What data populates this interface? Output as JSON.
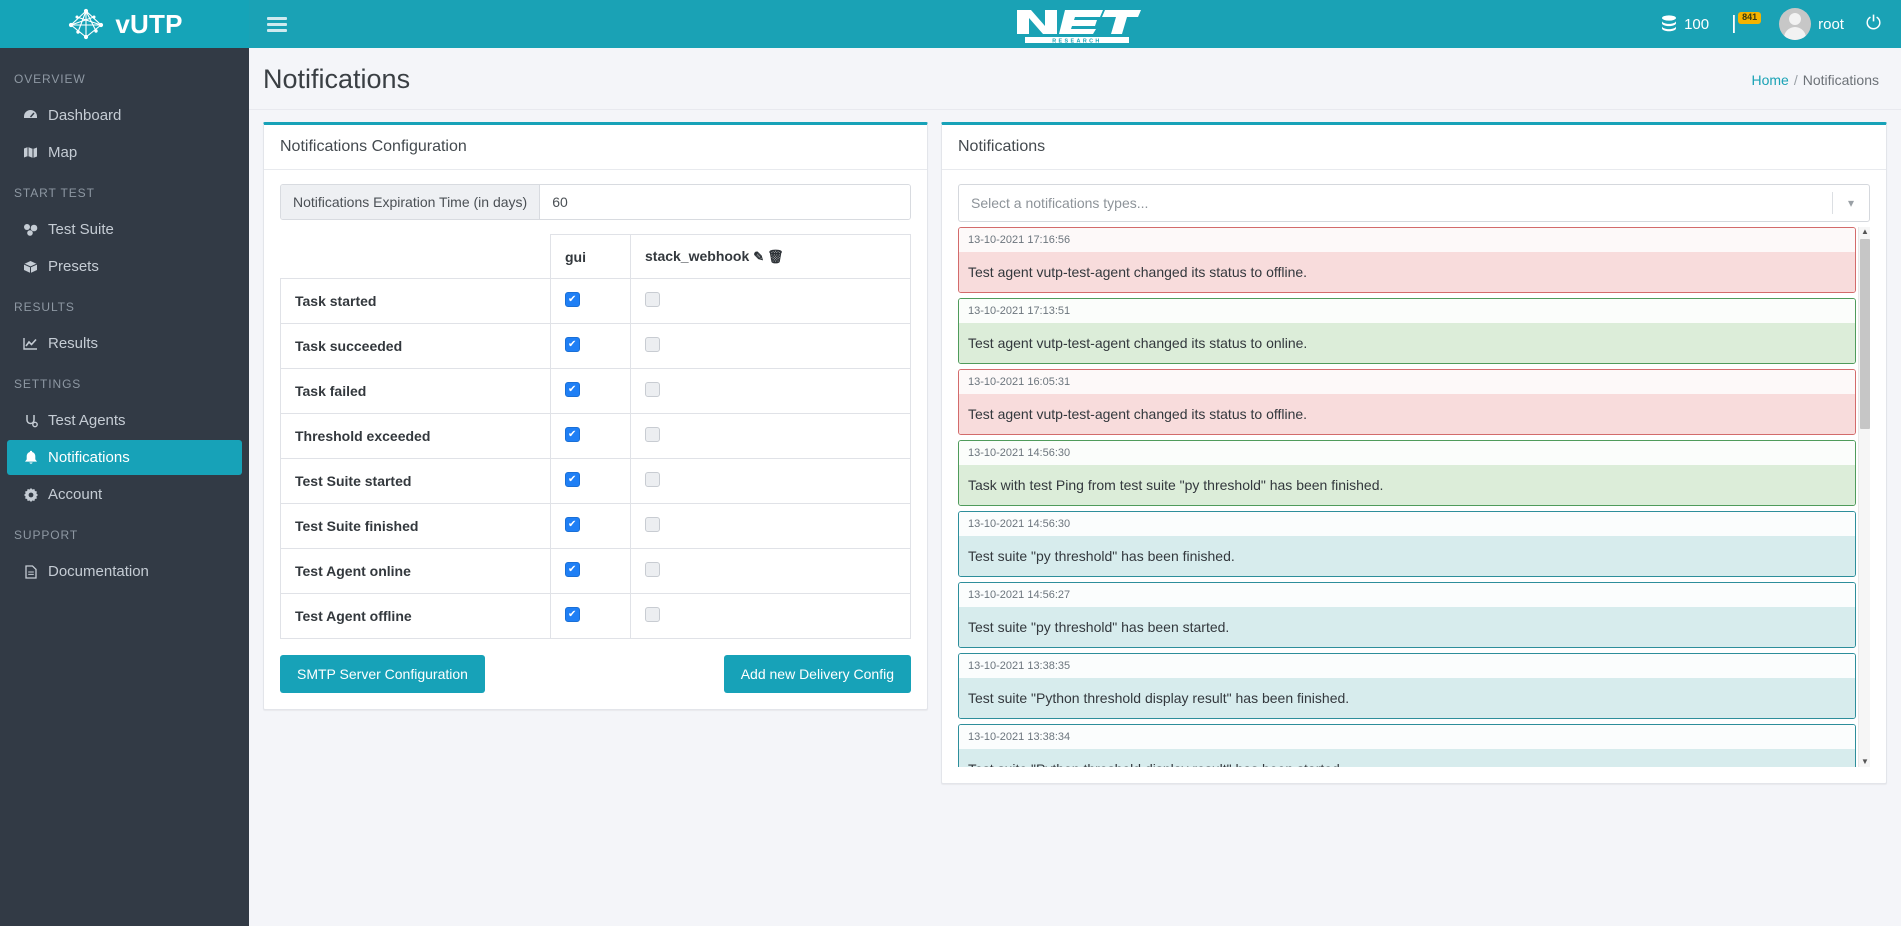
{
  "brand": {
    "name": "vUTP",
    "logo_icon": "network-mesh-icon"
  },
  "navbar": {
    "hamburger_icon": "hamburger-menu-icon",
    "center_logo_alt": "NET RESEARCH",
    "center_logo_main": "NET",
    "center_logo_sub": "R E S E A R C H",
    "credits_icon": "database-icon",
    "credits": "100",
    "flag_icon": "flag-icon",
    "flag_badge": "841",
    "avatar_icon": "user-avatar",
    "username": "root",
    "power_icon": "power-icon"
  },
  "sidebar": {
    "sections": [
      {
        "title": "OVERVIEW",
        "items": [
          {
            "label": "Dashboard",
            "icon": "dashboard-icon",
            "glyph": "◔",
            "active": false
          },
          {
            "label": "Map",
            "icon": "map-icon",
            "glyph": "▤",
            "active": false
          }
        ]
      },
      {
        "title": "START TEST",
        "items": [
          {
            "label": "Test Suite",
            "icon": "test-suite-icon",
            "glyph": "☸",
            "active": false
          },
          {
            "label": "Presets",
            "icon": "presets-box-icon",
            "glyph": "⬢",
            "active": false
          }
        ]
      },
      {
        "title": "RESULTS",
        "items": [
          {
            "label": "Results",
            "icon": "chart-line-icon",
            "glyph": "↗",
            "active": false
          }
        ]
      },
      {
        "title": "SETTINGS",
        "items": [
          {
            "label": "Test Agents",
            "icon": "stethoscope-icon",
            "glyph": "⚕",
            "active": false
          },
          {
            "label": "Notifications",
            "icon": "bell-icon",
            "glyph": "ὑ4",
            "active": true
          },
          {
            "label": "Account",
            "icon": "gear-icon",
            "glyph": "⚙",
            "active": false
          }
        ]
      },
      {
        "title": "SUPPORT",
        "items": [
          {
            "label": "Documentation",
            "icon": "document-icon",
            "glyph": "Ὄ4",
            "active": false
          }
        ]
      }
    ]
  },
  "page": {
    "title": "Notifications",
    "breadcrumb": {
      "home": "Home",
      "separator": "/",
      "current": "Notifications"
    }
  },
  "config_panel": {
    "title": "Notifications Configuration",
    "expiration": {
      "label": "Notifications Expiration Time (in days)",
      "value": "60",
      "placeholder": ""
    },
    "table": {
      "headers": [
        "",
        "gui",
        "stack_webhook"
      ],
      "webhook_edit_icon": "edit-pencil-icon",
      "webhook_delete_icon": "trash-icon",
      "rows": [
        {
          "event": "Task started",
          "gui": true,
          "stack_webhook": false
        },
        {
          "event": "Task succeeded",
          "gui": true,
          "stack_webhook": false
        },
        {
          "event": "Task failed",
          "gui": true,
          "stack_webhook": false
        },
        {
          "event": "Threshold exceeded",
          "gui": true,
          "stack_webhook": false
        },
        {
          "event": "Test Suite started",
          "gui": true,
          "stack_webhook": false
        },
        {
          "event": "Test Suite finished",
          "gui": true,
          "stack_webhook": false
        },
        {
          "event": "Test Agent online",
          "gui": true,
          "stack_webhook": false
        },
        {
          "event": "Test Agent offline",
          "gui": true,
          "stack_webhook": false
        }
      ]
    },
    "buttons": {
      "smtp": "SMTP Server Configuration",
      "add_delivery": "Add new Delivery Config"
    }
  },
  "notifications_panel": {
    "title": "Notifications",
    "filter": {
      "placeholder": "Select a notifications types...",
      "value": "",
      "chevron_icon": "chevron-down-icon"
    },
    "scrollbar": {
      "up_arrow_icon": "caret-up-icon",
      "down_arrow_icon": "caret-down-icon"
    },
    "items": [
      {
        "time": "13-10-2021 17:16:56",
        "message": "Test agent vutp-test-agent changed its status to offline.",
        "type": "danger"
      },
      {
        "time": "13-10-2021 17:13:51",
        "message": "Test agent vutp-test-agent changed its status to online.",
        "type": "success"
      },
      {
        "time": "13-10-2021 16:05:31",
        "message": "Test agent vutp-test-agent changed its status to offline.",
        "type": "danger"
      },
      {
        "time": "13-10-2021 14:56:30",
        "message": "Task with test Ping from test suite \"py threshold\" has been finished.",
        "type": "success"
      },
      {
        "time": "13-10-2021 14:56:30",
        "message": "Test suite \"py threshold\" has been finished.",
        "type": "info"
      },
      {
        "time": "13-10-2021 14:56:27",
        "message": "Test suite \"py threshold\" has been started.",
        "type": "info"
      },
      {
        "time": "13-10-2021 13:38:35",
        "message": "Test suite \"Python threshold display result\" has been finished.",
        "type": "info"
      },
      {
        "time": "13-10-2021 13:38:34",
        "message": "Test suite \"Python threshold display result\" has been started.",
        "type": "info"
      }
    ]
  },
  "colors": {
    "brand_teal": "#15a4b8",
    "navbar_teal": "#1aa2b5",
    "sidebar_dark": "#323a45",
    "active_item": "#17a2b8",
    "checkbox_on": "#1f7ff5",
    "badge_yellow": "#f5b300"
  }
}
